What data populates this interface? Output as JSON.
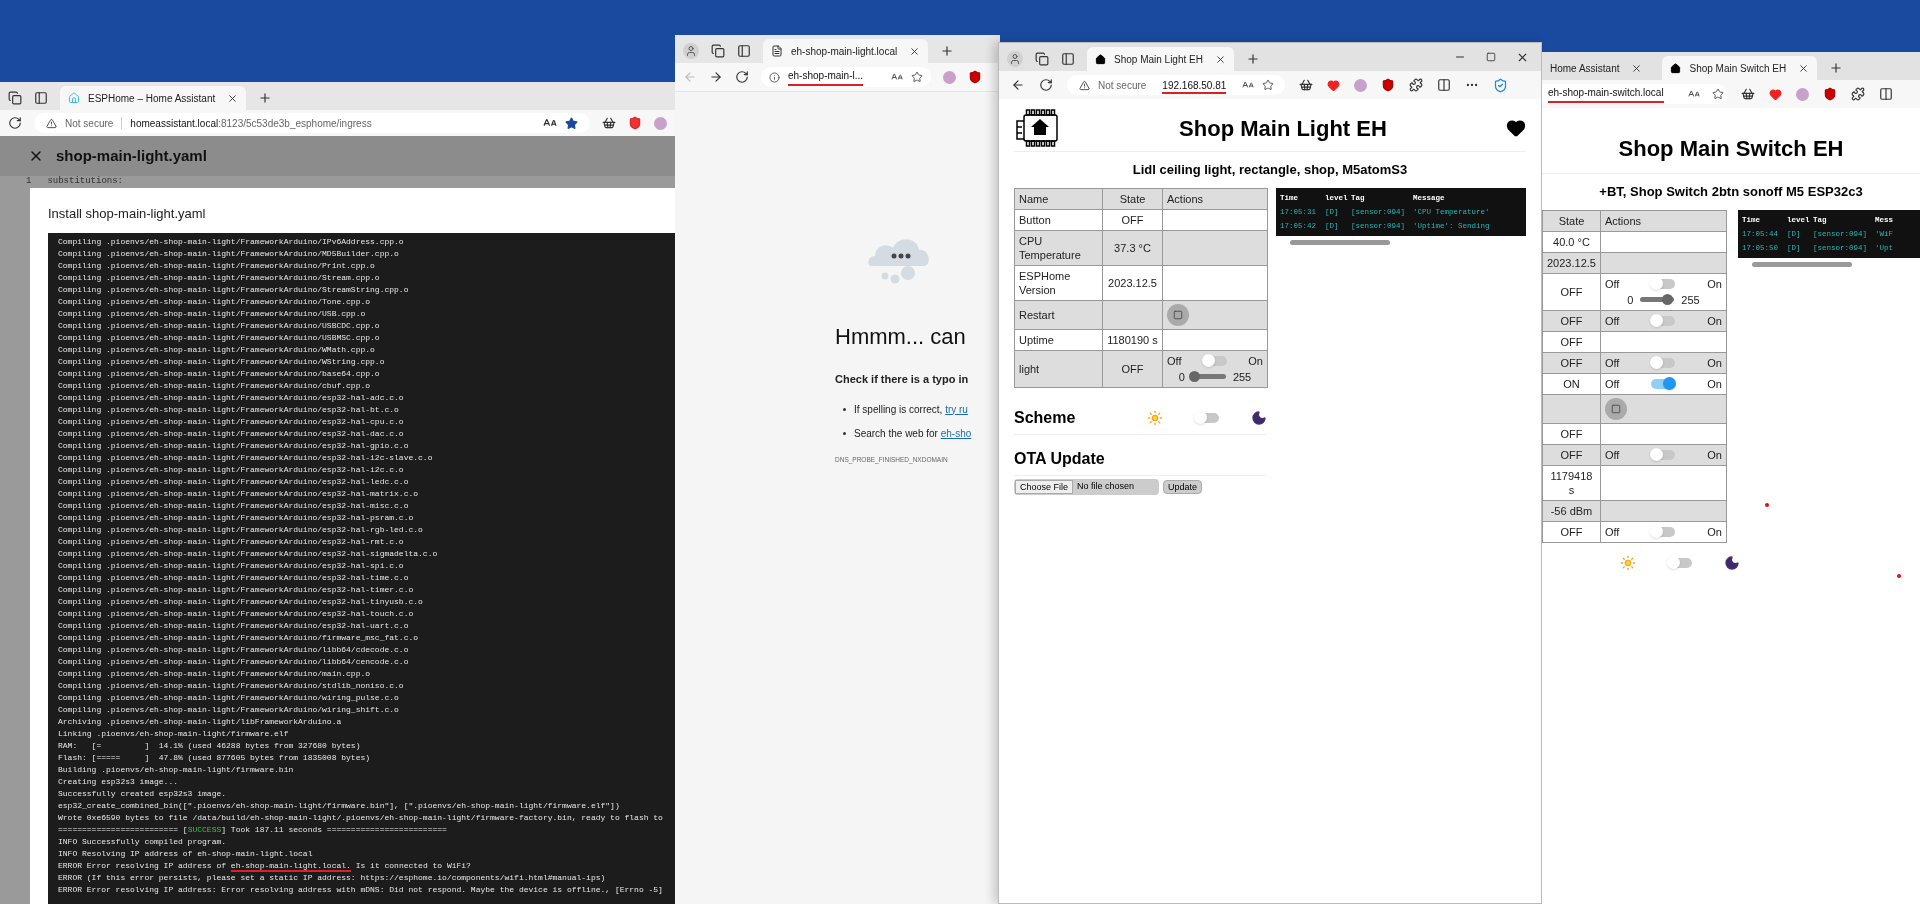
{
  "esphome_window": {
    "tab": {
      "title": "ESPHome – Home Assistant"
    },
    "address": {
      "security": "Not secure",
      "host": "homeassistant.local",
      "rest": ":8123/5c53de3b_esphome/ingress"
    },
    "editor": {
      "title": "shop-main-light.yaml",
      "line_number": "1",
      "first_line": "substitutions:"
    },
    "dialog": {
      "title": "Install shop-main-light.yaml",
      "log": [
        {
          "kind": "plain",
          "text": "Compiling .pioenvs/eh-shop-main-light/FrameworkArduino/IPv6Address.cpp.o"
        },
        {
          "kind": "plain",
          "text": "Compiling .pioenvs/eh-shop-main-light/FrameworkArduino/MD5Builder.cpp.o"
        },
        {
          "kind": "plain",
          "text": "Compiling .pioenvs/eh-shop-main-light/FrameworkArduino/Print.cpp.o"
        },
        {
          "kind": "plain",
          "text": "Compiling .pioenvs/eh-shop-main-light/FrameworkArduino/Stream.cpp.o"
        },
        {
          "kind": "plain",
          "text": "Compiling .pioenvs/eh-shop-main-light/FrameworkArduino/StreamString.cpp.o"
        },
        {
          "kind": "plain",
          "text": "Compiling .pioenvs/eh-shop-main-light/FrameworkArduino/Tone.cpp.o"
        },
        {
          "kind": "plain",
          "text": "Compiling .pioenvs/eh-shop-main-light/FrameworkArduino/USB.cpp.o"
        },
        {
          "kind": "plain",
          "text": "Compiling .pioenvs/eh-shop-main-light/FrameworkArduino/USBCDC.cpp.o"
        },
        {
          "kind": "plain",
          "text": "Compiling .pioenvs/eh-shop-main-light/FrameworkArduino/USBMSC.cpp.o"
        },
        {
          "kind": "plain",
          "text": "Compiling .pioenvs/eh-shop-main-light/FrameworkArduino/WMath.cpp.o"
        },
        {
          "kind": "plain",
          "text": "Compiling .pioenvs/eh-shop-main-light/FrameworkArduino/WString.cpp.o"
        },
        {
          "kind": "plain",
          "text": "Compiling .pioenvs/eh-shop-main-light/FrameworkArduino/base64.cpp.o"
        },
        {
          "kind": "plain",
          "text": "Compiling .pioenvs/eh-shop-main-light/FrameworkArduino/cbuf.cpp.o"
        },
        {
          "kind": "plain",
          "text": "Compiling .pioenvs/eh-shop-main-light/FrameworkArduino/esp32-hal-adc.c.o"
        },
        {
          "kind": "plain",
          "text": "Compiling .pioenvs/eh-shop-main-light/FrameworkArduino/esp32-hal-bt.c.o"
        },
        {
          "kind": "plain",
          "text": "Compiling .pioenvs/eh-shop-main-light/FrameworkArduino/esp32-hal-cpu.c.o"
        },
        {
          "kind": "plain",
          "text": "Compiling .pioenvs/eh-shop-main-light/FrameworkArduino/esp32-hal-dac.c.o"
        },
        {
          "kind": "plain",
          "text": "Compiling .pioenvs/eh-shop-main-light/FrameworkArduino/esp32-hal-gpio.c.o"
        },
        {
          "kind": "plain",
          "text": "Compiling .pioenvs/eh-shop-main-light/FrameworkArduino/esp32-hal-i2c-slave.c.o"
        },
        {
          "kind": "plain",
          "text": "Compiling .pioenvs/eh-shop-main-light/FrameworkArduino/esp32-hal-i2c.c.o"
        },
        {
          "kind": "plain",
          "text": "Compiling .pioenvs/eh-shop-main-light/FrameworkArduino/esp32-hal-ledc.c.o"
        },
        {
          "kind": "plain",
          "text": "Compiling .pioenvs/eh-shop-main-light/FrameworkArduino/esp32-hal-matrix.c.o"
        },
        {
          "kind": "plain",
          "text": "Compiling .pioenvs/eh-shop-main-light/FrameworkArduino/esp32-hal-misc.c.o"
        },
        {
          "kind": "plain",
          "text": "Compiling .pioenvs/eh-shop-main-light/FrameworkArduino/esp32-hal-psram.c.o"
        },
        {
          "kind": "plain",
          "text": "Compiling .pioenvs/eh-shop-main-light/FrameworkArduino/esp32-hal-rgb-led.c.o"
        },
        {
          "kind": "plain",
          "text": "Compiling .pioenvs/eh-shop-main-light/FrameworkArduino/esp32-hal-rmt.c.o"
        },
        {
          "kind": "plain",
          "text": "Compiling .pioenvs/eh-shop-main-light/FrameworkArduino/esp32-hal-sigmadelta.c.o"
        },
        {
          "kind": "plain",
          "text": "Compiling .pioenvs/eh-shop-main-light/FrameworkArduino/esp32-hal-spi.c.o"
        },
        {
          "kind": "plain",
          "text": "Compiling .pioenvs/eh-shop-main-light/FrameworkArduino/esp32-hal-time.c.o"
        },
        {
          "kind": "plain",
          "text": "Compiling .pioenvs/eh-shop-main-light/FrameworkArduino/esp32-hal-timer.c.o"
        },
        {
          "kind": "plain",
          "text": "Compiling .pioenvs/eh-shop-main-light/FrameworkArduino/esp32-hal-tinyusb.c.o"
        },
        {
          "kind": "plain",
          "text": "Compiling .pioenvs/eh-shop-main-light/FrameworkArduino/esp32-hal-touch.c.o"
        },
        {
          "kind": "plain",
          "text": "Compiling .pioenvs/eh-shop-main-light/FrameworkArduino/esp32-hal-uart.c.o"
        },
        {
          "kind": "plain",
          "text": "Compiling .pioenvs/eh-shop-main-light/FrameworkArduino/firmware_msc_fat.c.o"
        },
        {
          "kind": "plain",
          "text": "Compiling .pioenvs/eh-shop-main-light/FrameworkArduino/libb64/cdecode.c.o"
        },
        {
          "kind": "plain",
          "text": "Compiling .pioenvs/eh-shop-main-light/FrameworkArduino/libb64/cencode.c.o"
        },
        {
          "kind": "plain",
          "text": "Compiling .pioenvs/eh-shop-main-light/FrameworkArduino/main.cpp.o"
        },
        {
          "kind": "plain",
          "text": "Compiling .pioenvs/eh-shop-main-light/FrameworkArduino/stdlib_noniso.c.o"
        },
        {
          "kind": "plain",
          "text": "Compiling .pioenvs/eh-shop-main-light/FrameworkArduino/wiring_pulse.c.o"
        },
        {
          "kind": "plain",
          "text": "Compiling .pioenvs/eh-shop-main-light/FrameworkArduino/wiring_shift.c.o"
        },
        {
          "kind": "plain",
          "text": "Archiving .pioenvs/eh-shop-main-light/libFrameworkArduino.a"
        },
        {
          "kind": "plain",
          "text": "Linking .pioenvs/eh-shop-main-light/firmware.elf"
        },
        {
          "kind": "plain",
          "text": "RAM:   [=         ]  14.1% (used 46288 bytes from 327680 bytes)"
        },
        {
          "kind": "plain",
          "text": "Flash: [=====     ]  47.8% (used 877605 bytes from 1835008 bytes)"
        },
        {
          "kind": "plain",
          "text": "Building .pioenvs/eh-shop-main-light/firmware.bin"
        },
        {
          "kind": "plain",
          "text": "Creating esp32s3 image..."
        },
        {
          "kind": "plain",
          "text": "Successfully created esp32s3 image."
        },
        {
          "kind": "plain",
          "text": "esp32_create_combined_bin([\".pioenvs/eh-shop-main-light/firmware.bin\"], [\".pioenvs/eh-shop-main-light/firmware.elf\"])"
        },
        {
          "kind": "plain",
          "text": "Wrote 0xe6590 bytes to file /data/build/eh-shop-main-light/.pioenvs/eh-shop-main-light/firmware-factory.bin, ready to flash to"
        },
        {
          "kind": "success",
          "parts": [
            "========================= [",
            "SUCCESS",
            "] Took 187.11 seconds ========================="
          ]
        },
        {
          "kind": "plain",
          "text": "INFO Successfully compiled program."
        },
        {
          "kind": "plain",
          "text": "INFO Resolving IP address of eh-shop-main-light.local"
        },
        {
          "kind": "marked",
          "parts": [
            "ERROR Error resolving IP address of ",
            "eh-shop-main-light.local.",
            "Is it connected to WiFi?"
          ]
        },
        {
          "kind": "plain",
          "text": "ERROR (If this error persists, please set a static IP address: https://esphome.io/components/wifi.html#manual-ips)"
        },
        {
          "kind": "plain",
          "text": "ERROR Error resolving IP address: Error resolving address with mDNS: Did not respond. Maybe the device is offline., [Errno -5]"
        }
      ]
    }
  },
  "error_window": {
    "tab": {
      "title": "eh-shop-main-light.local"
    },
    "address": {
      "url": "eh-shop-main-l...",
      "underlined": true
    },
    "page": {
      "heading": "Hmmm... can",
      "subheading": "Check if there is a typo in",
      "bullets": [
        {
          "text": "If spelling is correct,",
          "link": "try ru"
        },
        {
          "text": "Search the web for",
          "link": "eh-sho"
        }
      ],
      "code": "DNS_PROBE_FINISHED_NXDOMAIN"
    }
  },
  "light_window": {
    "tab": {
      "title": "Shop Main Light EH"
    },
    "address": {
      "security": "Not secure",
      "url": "192.168.50.81",
      "underlined": true
    },
    "title": "Shop Main Light EH",
    "subtitle": "Lidl ceiling light, rectangle, shop, M5atomS3",
    "table": {
      "columns": [
        "Name",
        "State",
        "Actions"
      ],
      "rows": [
        {
          "name": "Button",
          "state": "OFF",
          "action": {
            "kind": "none"
          }
        },
        {
          "name": "CPU Temperature",
          "state": "37.3 °C",
          "action": {
            "kind": "none"
          }
        },
        {
          "name": "ESPHome Version",
          "state": "2023.12.5",
          "action": {
            "kind": "none"
          }
        },
        {
          "name": "Restart",
          "action": {
            "kind": "button"
          }
        },
        {
          "name": "Uptime",
          "state": "1180190 s",
          "action": {
            "kind": "none"
          }
        },
        {
          "name": "light",
          "state": "OFF",
          "action": {
            "kind": "light",
            "off_label": "Off",
            "on_label": "On",
            "on": false,
            "min": "0",
            "max": "255",
            "level": 0
          }
        }
      ]
    },
    "log": {
      "columns": [
        "Time",
        "level",
        "Tag",
        "Message"
      ],
      "rows": [
        {
          "time": "17:05:31",
          "level": "[D]",
          "tag": "[sensor:094]",
          "message": "'CPU Temperature'"
        },
        {
          "time": "17:05:42",
          "level": "[D]",
          "tag": "[sensor:094]",
          "message": "'Uptime': Sending"
        }
      ]
    },
    "scheme": {
      "title": "Scheme",
      "dark": false
    },
    "ota": {
      "title": "OTA Update",
      "choose": "Choose File",
      "file": "No file chosen",
      "button": "Update"
    }
  },
  "switch_window": {
    "tabs": [
      {
        "title": "Home Assistant",
        "selected": false
      },
      {
        "title": "Shop Main Switch EH",
        "selected": true
      }
    ],
    "address": {
      "url": "eh-shop-main-switch.local",
      "underlined": true
    },
    "title": "Shop Main Switch EH",
    "subtitle": "+BT, Shop Switch 2btn sonoff M5 ESP32c3",
    "table": {
      "columns": [
        "State",
        "Actions"
      ],
      "rows": [
        {
          "state": "40.0 °C",
          "action": {
            "kind": "none"
          }
        },
        {
          "state": "2023.12.5",
          "action": {
            "kind": "none"
          }
        },
        {
          "state": "OFF",
          "action": {
            "kind": "light",
            "off_label": "Off",
            "on_label": "On",
            "on": false,
            "min": "0",
            "max": "255",
            "level": 0.85
          }
        },
        {
          "state": "OFF",
          "action": {
            "kind": "toggle",
            "off_label": "Off",
            "on_label": "On",
            "on": false
          }
        },
        {
          "state": "OFF",
          "action": {
            "kind": "none"
          }
        },
        {
          "state": "OFF",
          "action": {
            "kind": "toggle",
            "off_label": "Off",
            "on_label": "On",
            "on": false
          }
        },
        {
          "state": "ON",
          "action": {
            "kind": "toggle",
            "off_label": "Off",
            "on_label": "On",
            "on": true
          }
        },
        {
          "action": {
            "kind": "button"
          }
        },
        {
          "state": "OFF",
          "action": {
            "kind": "none"
          }
        },
        {
          "state": "OFF",
          "action": {
            "kind": "toggle",
            "off_label": "Off",
            "on_label": "On",
            "on": false
          }
        },
        {
          "state": "1179418 s",
          "action": {
            "kind": "none"
          }
        },
        {
          "state": "-56 dBm",
          "action": {
            "kind": "none"
          }
        },
        {
          "state": "OFF",
          "action": {
            "kind": "toggle",
            "off_label": "Off",
            "on_label": "On",
            "on": false
          }
        }
      ]
    },
    "log": {
      "columns": [
        "Time",
        "level",
        "Tag",
        "Mess"
      ],
      "rows": [
        {
          "time": "17:05:44",
          "level": "[D]",
          "tag": "[sensor:094]",
          "message": "'WiF"
        },
        {
          "time": "17:05:50",
          "level": "[D]",
          "tag": "[sensor:094]",
          "message": "'Upt"
        }
      ]
    },
    "scheme": {
      "dark": false
    }
  }
}
